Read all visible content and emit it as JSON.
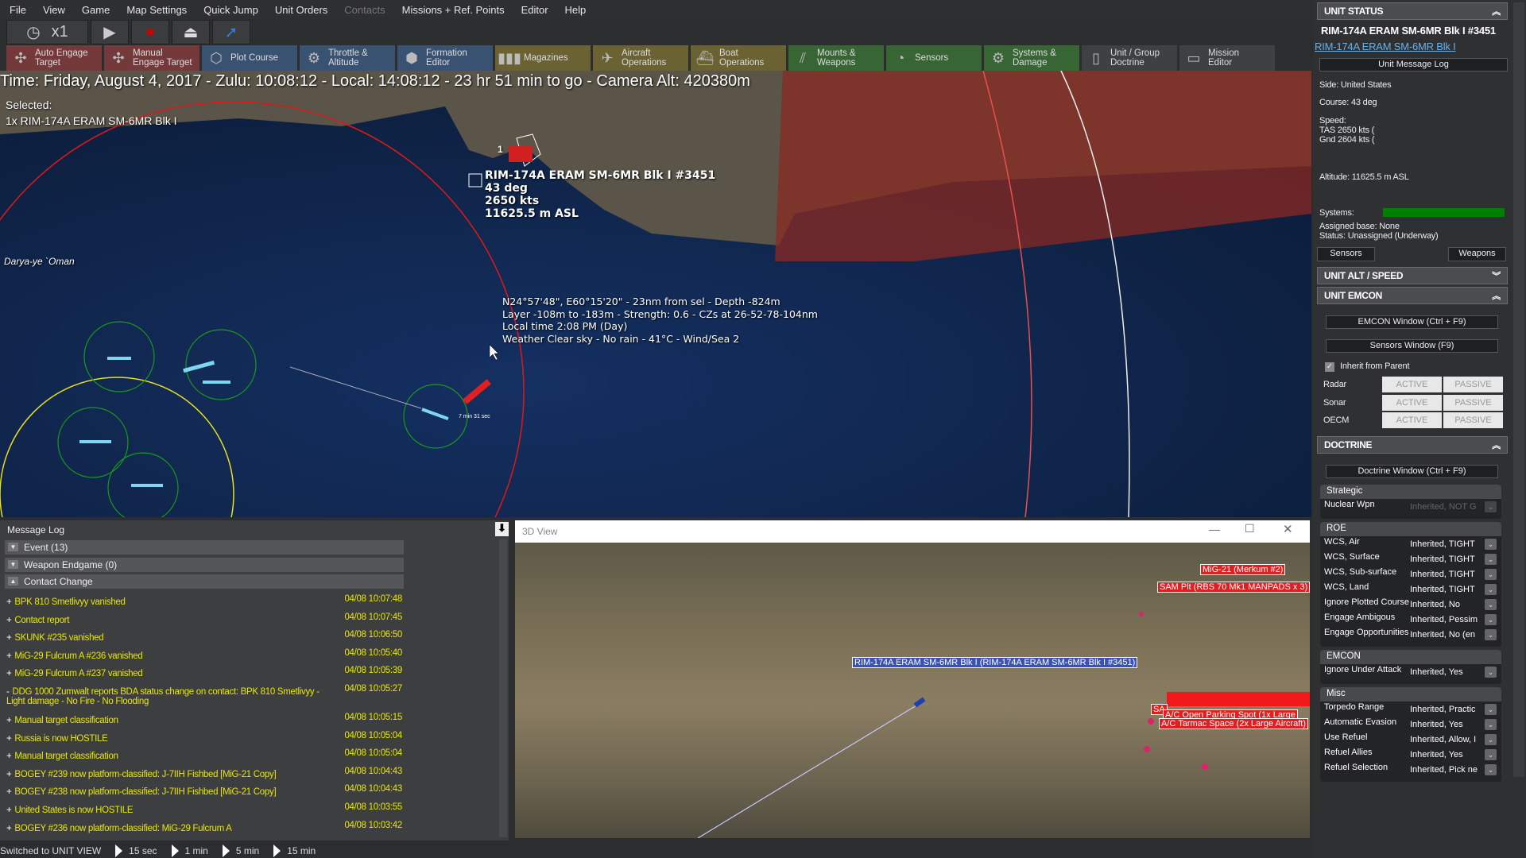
{
  "menu": [
    "File",
    "View",
    "Game",
    "Map Settings",
    "Quick Jump",
    "Unit Orders",
    "Contacts",
    "Missions + Ref. Points",
    "Editor",
    "Help"
  ],
  "toolbar": {
    "speed": "x1"
  },
  "commands": [
    {
      "l1": "Auto Engage",
      "l2": "Target",
      "color": "red",
      "icon": "auto-engage-icon"
    },
    {
      "l1": "Manual",
      "l2": "Engage Target",
      "color": "red",
      "icon": "manual-engage-icon"
    },
    {
      "l1": "Plot Course",
      "l2": "",
      "color": "blue",
      "icon": "plot-course-icon"
    },
    {
      "l1": "Throttle &",
      "l2": "Altitude",
      "color": "blue",
      "icon": "throttle-icon"
    },
    {
      "l1": "Formation",
      "l2": "Editor",
      "color": "blue",
      "icon": "formation-icon"
    },
    {
      "l1": "Magazines",
      "l2": "",
      "color": "olive",
      "icon": "magazines-icon"
    },
    {
      "l1": "Aircraft",
      "l2": "Operations",
      "color": "olive",
      "icon": "aircraft-icon"
    },
    {
      "l1": "Boat",
      "l2": "Operations",
      "color": "olive",
      "icon": "boat-icon"
    },
    {
      "l1": "Mounts &",
      "l2": "Weapons",
      "color": "green",
      "icon": "mounts-icon"
    },
    {
      "l1": "Sensors",
      "l2": "",
      "color": "green",
      "icon": "sensors-icon"
    },
    {
      "l1": "Systems &",
      "l2": "Damage",
      "color": "green",
      "icon": "gear-icon"
    },
    {
      "l1": "Unit / Group",
      "l2": "Doctrine",
      "color": "gray",
      "icon": "doctrine-icon"
    },
    {
      "l1": "Mission",
      "l2": "Editor",
      "color": "gray",
      "icon": "mission-editor-icon"
    }
  ],
  "map": {
    "time": "Time: Friday, August 4, 2017 - Zulu: 10:08:12 - Local: 14:08:12 - 23 hr 51 min to go -  Camera Alt: 420380m",
    "selected_label": "Selected:",
    "selected_unit": "1x RIM-174A ERAM SM-6MR Blk I",
    "unit_label": [
      "RIM-174A ERAM SM-6MR Blk I #3451",
      "43 deg",
      "2650 kts",
      "11625.5 m ASL"
    ],
    "unit_count": "1",
    "sea_label": "Darya-ye `Oman",
    "cursor_info": [
      "N24°57'48\", E60°15'20\" - 23nm from sel - Depth -824m",
      "Layer -108m to -183m - Strength: 0.6 - CZs at 26-52-78-104nm",
      "Local time 2:08 PM (Day)",
      "Weather Clear sky - No rain - 41°C - Wind/Sea 2"
    ],
    "eta_label": "7 min 31 sec"
  },
  "unit_status": {
    "header": "UNIT STATUS",
    "name": "RIM-174A ERAM SM-6MR Blk I #3451",
    "class_link": "RIM-174A ERAM SM-6MR Blk I",
    "log_button": "Unit Message Log",
    "side": "Side: United States",
    "course": "Course: 43 deg",
    "speed_label": "Speed:",
    "tas": "TAS 2650 kts (",
    "gnd": "Gnd 2604 kts (",
    "altitude": "Altitude: 11625.5 m ASL",
    "systems_label": "Systems:",
    "systems_health": 1.0,
    "systems_color": "#008000",
    "base": "Assigned base: None",
    "status": "Status: Unassigned (Underway)",
    "sensors_button": "Sensors",
    "weapons_button": "Weapons"
  },
  "alt_speed": {
    "header": "UNIT ALT / SPEED"
  },
  "emcon": {
    "header": "UNIT EMCON",
    "emcon_window": "EMCON Window (Ctrl + F9)",
    "sensors_window": "Sensors Window (F9)",
    "inherit": "Inherit from Parent",
    "inherit_checked": true,
    "rows": [
      {
        "name": "Radar",
        "a": "ACTIVE",
        "p": "PASSIVE"
      },
      {
        "name": "Sonar",
        "a": "ACTIVE",
        "p": "PASSIVE"
      },
      {
        "name": "OECM",
        "a": "ACTIVE",
        "p": "PASSIVE"
      }
    ]
  },
  "doctrine": {
    "header": "DOCTRINE",
    "window": "Doctrine Window (Ctrl + F9)",
    "groups": [
      {
        "name": "Strategic",
        "rows": [
          {
            "k": "Nuclear Wpn",
            "v": "Inherited, NOT G",
            "disabled": true
          }
        ]
      },
      {
        "name": "ROE",
        "rows": [
          {
            "k": "WCS, Air",
            "v": "Inherited, TIGHT"
          },
          {
            "k": "WCS, Surface",
            "v": "Inherited, TIGHT"
          },
          {
            "k": "WCS, Sub-surface",
            "v": "Inherited, TIGHT"
          },
          {
            "k": "WCS, Land",
            "v": "Inherited, TIGHT"
          },
          {
            "k": "Ignore Plotted Course",
            "v": "Inherited, No"
          },
          {
            "k": "Engage Ambigous",
            "v": "Inherited, Pessim"
          },
          {
            "k": "Engage Opportunities",
            "v": "Inherited, No (en"
          }
        ]
      },
      {
        "name": "EMCON",
        "rows": [
          {
            "k": "Ignore Under Attack",
            "v": "Inherited, Yes"
          }
        ]
      },
      {
        "name": "Misc",
        "rows": [
          {
            "k": "Torpedo Range",
            "v": "Inherited, Practic"
          },
          {
            "k": "Automatic Evasion",
            "v": "Inherited, Yes"
          },
          {
            "k": "Use Refuel",
            "v": "Inherited, Allow, I"
          },
          {
            "k": "Refuel Allies",
            "v": "Inherited, Yes"
          },
          {
            "k": "Refuel Selection",
            "v": "Inherited, Pick ne"
          }
        ]
      }
    ]
  },
  "log": {
    "title": "Message Log",
    "groups": [
      {
        "label": "Event (13)",
        "open": false
      },
      {
        "label": "Weapon Endgame (0)",
        "open": false
      },
      {
        "label": "Contact Change",
        "open": true
      }
    ],
    "messages": [
      {
        "s": "+",
        "m": "BPK 810 Smetlivyy vanished",
        "t": "04/08 10:07:48"
      },
      {
        "s": "+",
        "m": "Contact report",
        "t": "04/08 10:07:45"
      },
      {
        "s": "+",
        "m": "SKUNK #235 vanished",
        "t": "04/08 10:06:50"
      },
      {
        "s": "+",
        "m": "MiG-29 Fulcrum A #236 vanished",
        "t": "04/08 10:05:40"
      },
      {
        "s": "+",
        "m": "MiG-29 Fulcrum A #237 vanished",
        "t": "04/08 10:05:39"
      },
      {
        "s": "-",
        "m": "DDG 1000 Zumwalt reports BDA status change on contact: BPK 810 Smetlivyy - Light damage - No Fire - No Flooding",
        "t": "04/08 10:05:27"
      },
      {
        "s": "+",
        "m": "Manual target classification",
        "t": "04/08 10:05:15"
      },
      {
        "s": "+",
        "m": "Russia is now HOSTILE",
        "t": "04/08 10:05:04"
      },
      {
        "s": "+",
        "m": "Manual target classification",
        "t": "04/08 10:05:04"
      },
      {
        "s": "+",
        "m": "BOGEY #239 now platform-classified: J-7IIH Fishbed [MiG-21 Copy]",
        "t": "04/08 10:04:43"
      },
      {
        "s": "+",
        "m": "BOGEY #238 now platform-classified: J-7IIH Fishbed [MiG-21 Copy]",
        "t": "04/08 10:04:43"
      },
      {
        "s": "+",
        "m": "United States is now HOSTILE",
        "t": "04/08 10:03:55"
      },
      {
        "s": "+",
        "m": "BOGEY #236 now platform-classified: MiG-29 Fulcrum A",
        "t": "04/08 10:03:42"
      }
    ]
  },
  "view3d": {
    "title": "3D View",
    "labels": {
      "mig": "MiG-21 (Merkum #2)",
      "sam": "SAM Plt (RBS 70 Mk1 MANPADS x 3)",
      "unit": "RIM-174A ERAM SM-6MR Blk I (RIM-174A ERAM SM-6MR Blk I #3451)",
      "parking": "A/C Open Parking Spot (1x Large",
      "tarmac": "A/C Tarmac Space (2x Large Aircraft)",
      "sam2": "SA"
    }
  },
  "status": {
    "text": "Switched to UNIT VIEW",
    "steps": [
      "15 sec",
      "1 min",
      "5 min",
      "15 min"
    ]
  }
}
